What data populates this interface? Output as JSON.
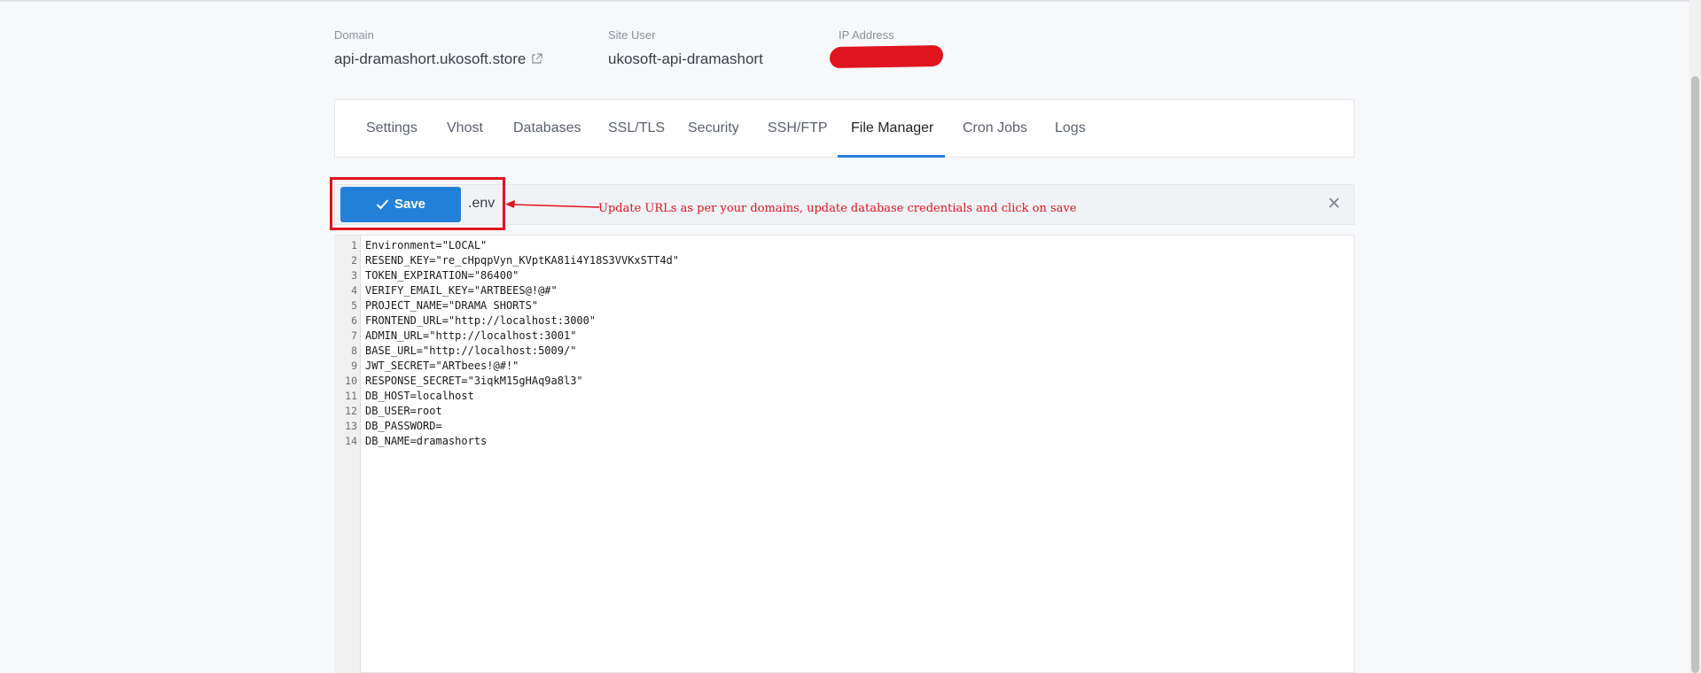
{
  "site_info": {
    "domain_label": "Domain",
    "domain_value": "api-dramashort.ukosoft.store",
    "site_user_label": "Site User",
    "site_user_value": "ukosoft-api-dramashort",
    "ip_label": "IP Address"
  },
  "tabs": [
    {
      "label": "Settings"
    },
    {
      "label": "Vhost"
    },
    {
      "label": "Databases"
    },
    {
      "label": "SSL/TLS"
    },
    {
      "label": "Security"
    },
    {
      "label": "SSH/FTP"
    },
    {
      "label": "File Manager",
      "active": true
    },
    {
      "label": "Cron Jobs"
    },
    {
      "label": "Logs"
    }
  ],
  "editor_toolbar": {
    "save_label": "Save",
    "filename": ".env",
    "annotation": "Update URLs as per your domains, update database credentials and click on save"
  },
  "editor": {
    "line_numbers": [
      "1",
      "2",
      "3",
      "4",
      "5",
      "6",
      "7",
      "8",
      "9",
      "10",
      "11",
      "12",
      "13",
      "14"
    ],
    "lines": [
      "Environment=\"LOCAL\"",
      "RESEND_KEY=\"re_cHpqpVyn_KVptKA81i4Y18S3VVKxSTT4d\"",
      "TOKEN_EXPIRATION=\"86400\"",
      "VERIFY_EMAIL_KEY=\"ARTBEES@!@#\"",
      "PROJECT_NAME=\"DRAMA SHORTS\"",
      "FRONTEND_URL=\"http://localhost:3000\"",
      "ADMIN_URL=\"http://localhost:3001\"",
      "BASE_URL=\"http://localhost:5009/\"",
      "JWT_SECRET=\"ARTbees!@#!\"",
      "RESPONSE_SECRET=\"3iqkM15gHAq9a8l3\"",
      "DB_HOST=localhost",
      "DB_USER=root",
      "DB_PASSWORD=",
      "DB_NAME=dramashorts"
    ]
  },
  "colors": {
    "accent": "#2380d9",
    "annotation_red": "#e0141e"
  }
}
